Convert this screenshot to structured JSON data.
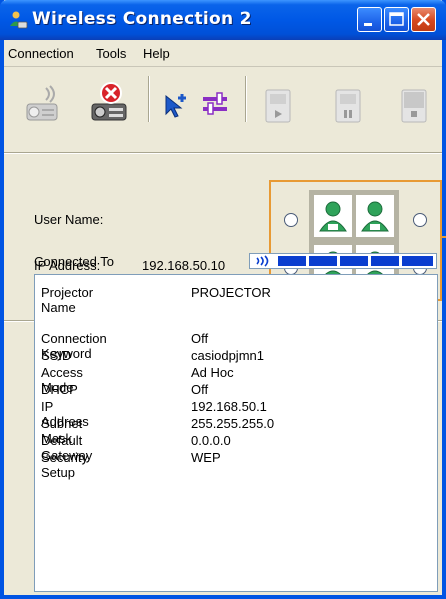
{
  "window": {
    "title": "Wireless Connection 2"
  },
  "menu": {
    "items": [
      {
        "label": "Connection"
      },
      {
        "label": "Tools"
      },
      {
        "label": "Help"
      }
    ]
  },
  "toolbar": {
    "buttons": [
      {
        "icon": "projector-search-icon"
      },
      {
        "icon": "projector-disconnect-icon"
      },
      {
        "icon": "cursor-plus-icon"
      },
      {
        "icon": "settings-sliders-icon"
      },
      {
        "icon": "play-icon"
      },
      {
        "icon": "pause-icon"
      },
      {
        "icon": "stop-icon"
      }
    ]
  },
  "info": {
    "user_name_label": "User Name:",
    "user_name_value": "",
    "ip_label": "IP Address:",
    "ip_value": "192.168.50.10"
  },
  "connected": {
    "label": "Connected To",
    "signal_icon": "wireless-signal-icon",
    "signal_segments_filled": 5
  },
  "projector": {
    "name_label": "Projector Name",
    "name_value": "PROJECTOR",
    "details": [
      {
        "key": "Connection Keyword",
        "value": "Off"
      },
      {
        "key": "SSID",
        "value": "casiodpjmn1"
      },
      {
        "key": "Access Mode",
        "value": "Ad Hoc"
      },
      {
        "key": "DHCP",
        "value": "Off"
      },
      {
        "key": "IP Address",
        "value": "192.168.50.1"
      },
      {
        "key": "Subnet Mask",
        "value": "255.255.255.0"
      },
      {
        "key": "Default Gateway",
        "value": "0.0.0.0"
      },
      {
        "key": "Security Setup",
        "value": "WEP"
      }
    ]
  },
  "colors": {
    "accent_orange": "#e89a34",
    "title_blue": "#0058e6",
    "signal_blue": "#0a3ecf"
  }
}
